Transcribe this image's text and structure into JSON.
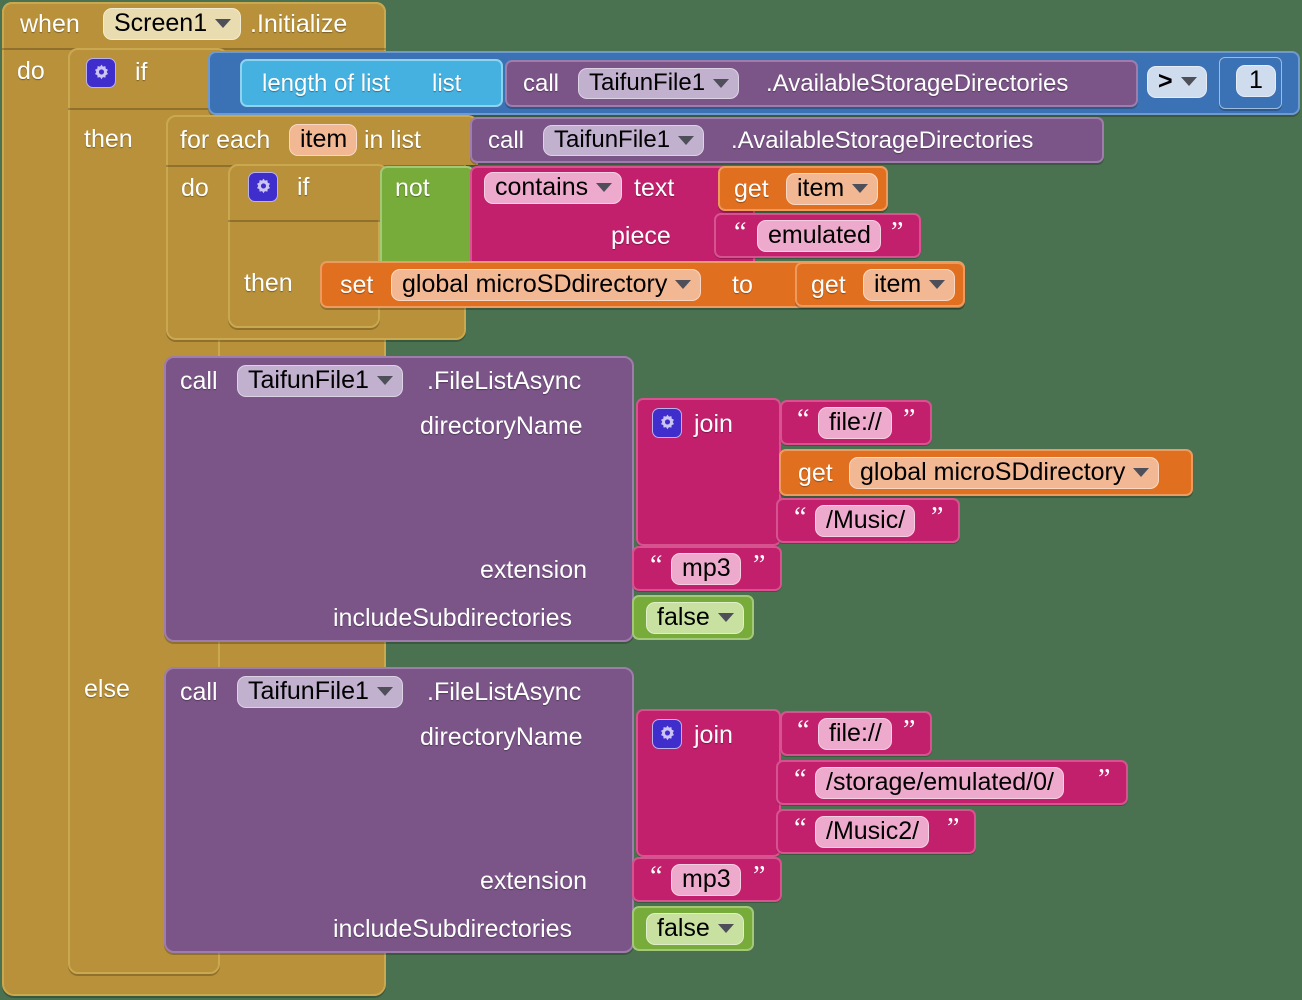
{
  "workspace": {
    "background_color": "#4a7150",
    "app": "MIT App Inventor Blocks Editor"
  },
  "colors": {
    "event_gold": "#b8913a",
    "control_gold": "#b8913a",
    "logic_green": "#77ab3a",
    "math_blue": "#3b72b5",
    "list_cyan": "#45b1e0",
    "text_magenta": "#c2206c",
    "variable_orange": "#e0701f",
    "component_purple": "#7b5588",
    "gear_indigo": "#3f2ecc"
  },
  "event_block": {
    "when_label": "when",
    "component": "Screen1",
    "event": ".Initialize",
    "do_label": "do"
  },
  "outer_if": {
    "if_label": "if",
    "then_label": "then",
    "else_label": "else",
    "gear_icon": "gear-icon"
  },
  "condition": {
    "list_length_label": "length of list",
    "list_socket_label": "list",
    "call_label": "call",
    "component": "TaifunFile1",
    "method": ".AvailableStorageDirectories",
    "operator": ">",
    "number": "1"
  },
  "for_each": {
    "for_each_label": "for each",
    "loop_var": "item",
    "in_list_label": "in list",
    "do_label": "do",
    "call_label": "call",
    "component": "TaifunFile1",
    "method": ".AvailableStorageDirectories"
  },
  "inner_if": {
    "if_label": "if",
    "then_label": "then",
    "not_label": "not",
    "contains_label": "contains",
    "text_label": "text",
    "piece_label": "piece",
    "get_label": "get",
    "get_var": "item",
    "piece_value": "emulated",
    "set_label": "set",
    "set_var": "global microSDdirectory",
    "to_label": "to",
    "set_get_label": "get",
    "set_get_var": "item"
  },
  "then_call": {
    "call_label": "call",
    "component": "TaifunFile1",
    "method": ".FileListAsync",
    "params": [
      {
        "name": "directoryName"
      },
      {
        "name": "extension"
      },
      {
        "name": "includeSubdirectories"
      }
    ],
    "join_label": "join",
    "join_args": [
      {
        "type": "text",
        "value": "file://"
      },
      {
        "type": "get",
        "label": "get",
        "value": "global microSDdirectory"
      },
      {
        "type": "text",
        "value": "/Music/"
      }
    ],
    "extension_value": "mp3",
    "include_subdirectories_value": "false"
  },
  "else_call": {
    "call_label": "call",
    "component": "TaifunFile1",
    "method": ".FileListAsync",
    "params": [
      {
        "name": "directoryName"
      },
      {
        "name": "extension"
      },
      {
        "name": "includeSubdirectories"
      }
    ],
    "join_label": "join",
    "join_args": [
      {
        "type": "text",
        "value": "file://"
      },
      {
        "type": "text",
        "value": "/storage/emulated/0/"
      },
      {
        "type": "text",
        "value": "/Music2/"
      }
    ],
    "extension_value": "mp3",
    "include_subdirectories_value": "false"
  }
}
